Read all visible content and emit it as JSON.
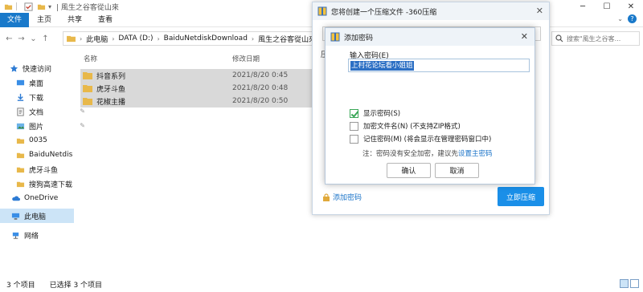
{
  "titlebar": {
    "path_title": "|  風生之谷客從山來",
    "controls": {
      "minimize": "─",
      "maximize": "☐",
      "close": "✕"
    }
  },
  "ribbon": {
    "tabs": [
      {
        "label": "文件"
      },
      {
        "label": "主页"
      },
      {
        "label": "共享"
      },
      {
        "label": "查看"
      }
    ],
    "help": "?"
  },
  "address": {
    "crumbs": [
      "此电脑",
      "DATA (D:)",
      "BaiduNetdiskDownload",
      "風生之谷客從山來"
    ],
    "search_placeholder": "搜索\"風生之谷客..."
  },
  "nav_pane": {
    "items": [
      {
        "label": "快速访问"
      },
      {
        "label": "桌面"
      },
      {
        "label": "下载"
      },
      {
        "label": "文档"
      },
      {
        "label": "图片"
      },
      {
        "label": "0035"
      },
      {
        "label": "BaiduNetdis"
      },
      {
        "label": "虎牙斗鱼"
      },
      {
        "label": "搜狗高速下载"
      },
      {
        "label": "OneDrive"
      },
      {
        "label": "此电脑"
      },
      {
        "label": "网络"
      }
    ]
  },
  "file_list": {
    "columns": {
      "name": "名称",
      "date": "修改日期"
    },
    "rows": [
      {
        "name": "抖音系列",
        "date": "2021/8/20 0:45"
      },
      {
        "name": "虎牙斗鱼",
        "date": "2021/8/20 0:48"
      },
      {
        "name": "花椒主播",
        "date": "2021/8/20 0:50"
      }
    ]
  },
  "status": {
    "count": "3 个项目",
    "selected": "已选择 3 个项目"
  },
  "zip_window": {
    "title": "您将创建一个压缩文件 -360压缩",
    "fragment": "压",
    "add_password": "添加密码",
    "compress_button": "立即压缩"
  },
  "password_dialog": {
    "title": "添加密码",
    "input_label": "输入密码(E)",
    "password_value": "上村花论坛看小姐姐",
    "options": [
      {
        "label": "显示密码(S)",
        "checked": true
      },
      {
        "label": "加密文件名(N) (不支持ZIP格式)",
        "checked": false
      },
      {
        "label": "记住密码(M) (将会显示在管理密码窗口中)",
        "checked": false
      }
    ],
    "note": "注：密码没有安全加密，建议先",
    "note_link": "设置主密码",
    "ok": "确认",
    "cancel": "取消"
  },
  "colors": {
    "accent": "#1979ca",
    "selection": "#cce4f7",
    "file_row_bg": "#d9d9d9",
    "zip_button": "#1a8fe8",
    "folder": "#e8b84a"
  }
}
